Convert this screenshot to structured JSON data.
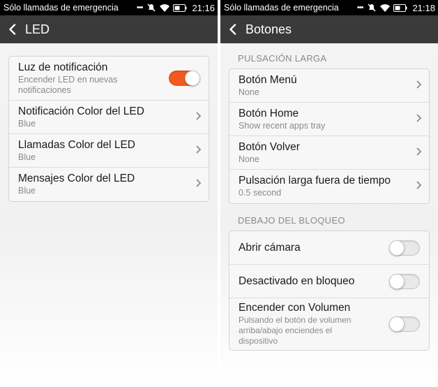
{
  "left": {
    "status": {
      "carrier": "Sólo llamadas de emergencia",
      "dots": "•••",
      "time": "21:16"
    },
    "title": "LED",
    "items": [
      {
        "title": "Luz de notificación",
        "subtitle": "Encender LED en nuevas notificaciones",
        "control": "toggle",
        "checked": true
      },
      {
        "title": "Notificación Color del LED",
        "subtitle": "Blue",
        "control": "chevron"
      },
      {
        "title": "Llamadas Color del LED",
        "subtitle": "Blue",
        "control": "chevron"
      },
      {
        "title": "Mensajes Color del LED",
        "subtitle": "Blue",
        "control": "chevron"
      }
    ]
  },
  "right": {
    "status": {
      "carrier": "Sólo llamadas de emergencia",
      "dots": "•••",
      "time": "21:18"
    },
    "title": "Botones",
    "sections": [
      {
        "header": "PULSACIÓN LARGA",
        "items": [
          {
            "title": "Botón Menú",
            "subtitle": "None",
            "control": "chevron"
          },
          {
            "title": "Botón Home",
            "subtitle": "Show recent apps tray",
            "control": "chevron"
          },
          {
            "title": "Botón Volver",
            "subtitle": "None",
            "control": "chevron"
          },
          {
            "title": "Pulsación larga fuera de tiempo",
            "subtitle": "0.5 second",
            "control": "chevron"
          }
        ]
      },
      {
        "header": "DEBAJO DEL BLOQUEO",
        "items": [
          {
            "title": "Abrir cámara",
            "control": "toggle",
            "checked": false
          },
          {
            "title": "Desactivado en bloqueo",
            "control": "toggle",
            "checked": false
          },
          {
            "title": "Encender con Volumen",
            "subtitle": "Pulsando el botón de volumen arriba/abajo enciendes el dispositivo",
            "control": "toggle",
            "checked": false
          }
        ]
      }
    ]
  },
  "colors": {
    "toggle_on": "#f25a1f",
    "actionbar": "#3a3a3a",
    "statusbar": "#000000"
  },
  "icons": {
    "status": [
      "muted-notification-icon",
      "wifi-icon",
      "battery-icon"
    ],
    "back": "back-arrow-icon",
    "chevron": "chevron-right-icon"
  }
}
